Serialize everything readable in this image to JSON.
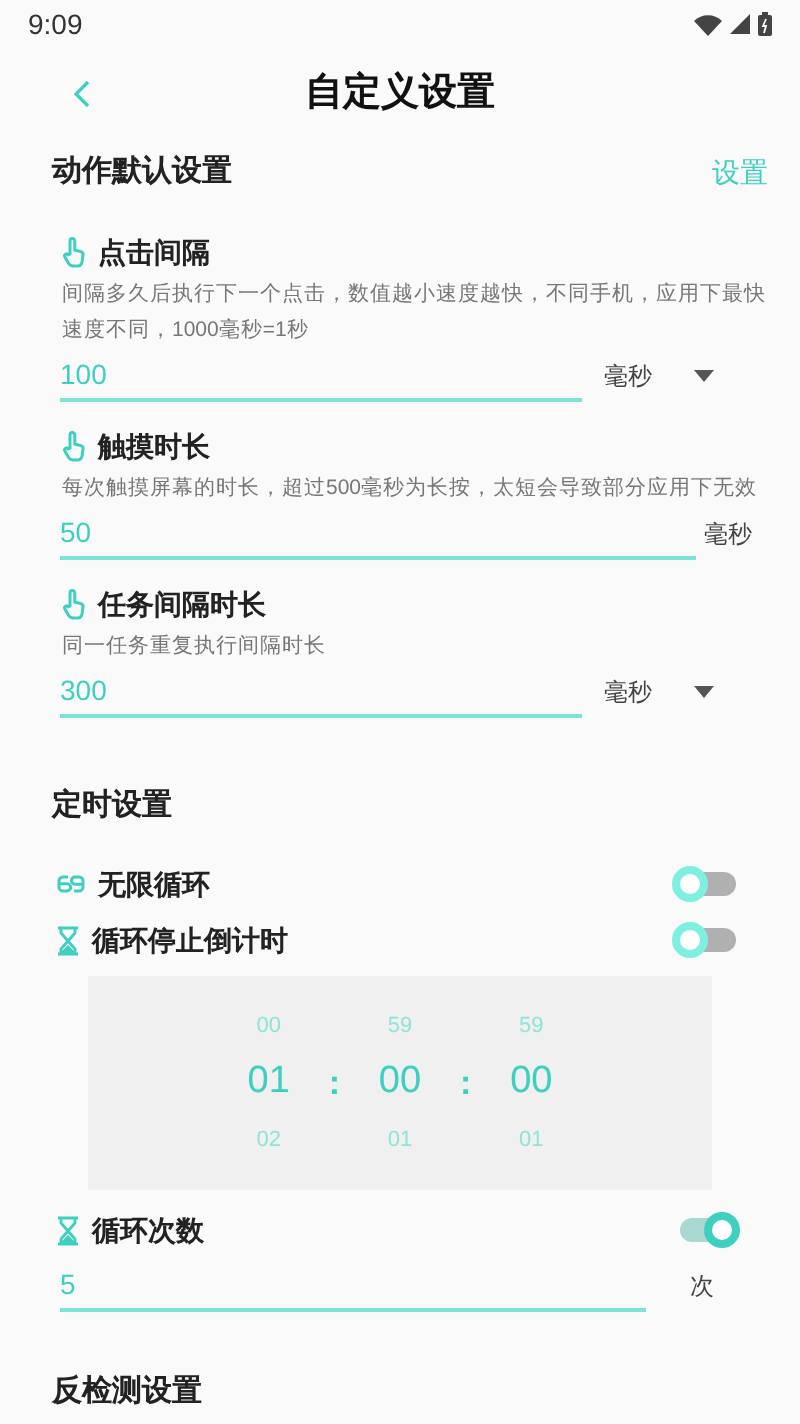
{
  "status_bar": {
    "time": "9:09"
  },
  "header": {
    "title": "自定义设置"
  },
  "action_section": {
    "title": "动作默认设置",
    "action": "设置",
    "items": [
      {
        "label": "点击间隔",
        "description": "间隔多久后执行下一个点击，数值越小速度越快，不同手机，应用下最快速度不同，1000毫秒=1秒",
        "value": "100",
        "unit": "毫秒",
        "dropdown": true
      },
      {
        "label": "触摸时长",
        "description": "每次触摸屏幕的时长，超过500毫秒为长按，太短会导致部分应用下无效",
        "value": "50",
        "unit": "毫秒",
        "dropdown": false
      },
      {
        "label": "任务间隔时长",
        "description": "同一任务重复执行间隔时长",
        "value": "300",
        "unit": "毫秒",
        "dropdown": true
      }
    ]
  },
  "timer_section": {
    "title": "定时设置",
    "infinite_loop": {
      "label": "无限循环",
      "on": false
    },
    "stop_countdown": {
      "label": "循环停止倒计时",
      "on": false
    },
    "picker": {
      "separator": ":",
      "columns": [
        {
          "prev": "00",
          "current": "01",
          "next": "02"
        },
        {
          "prev": "59",
          "current": "00",
          "next": "01"
        },
        {
          "prev": "59",
          "current": "00",
          "next": "01"
        }
      ]
    },
    "loop_count": {
      "label": "循环次数",
      "on": true,
      "value": "5",
      "unit": "次"
    }
  },
  "anti_detect_section": {
    "title": "反检测设置"
  }
}
